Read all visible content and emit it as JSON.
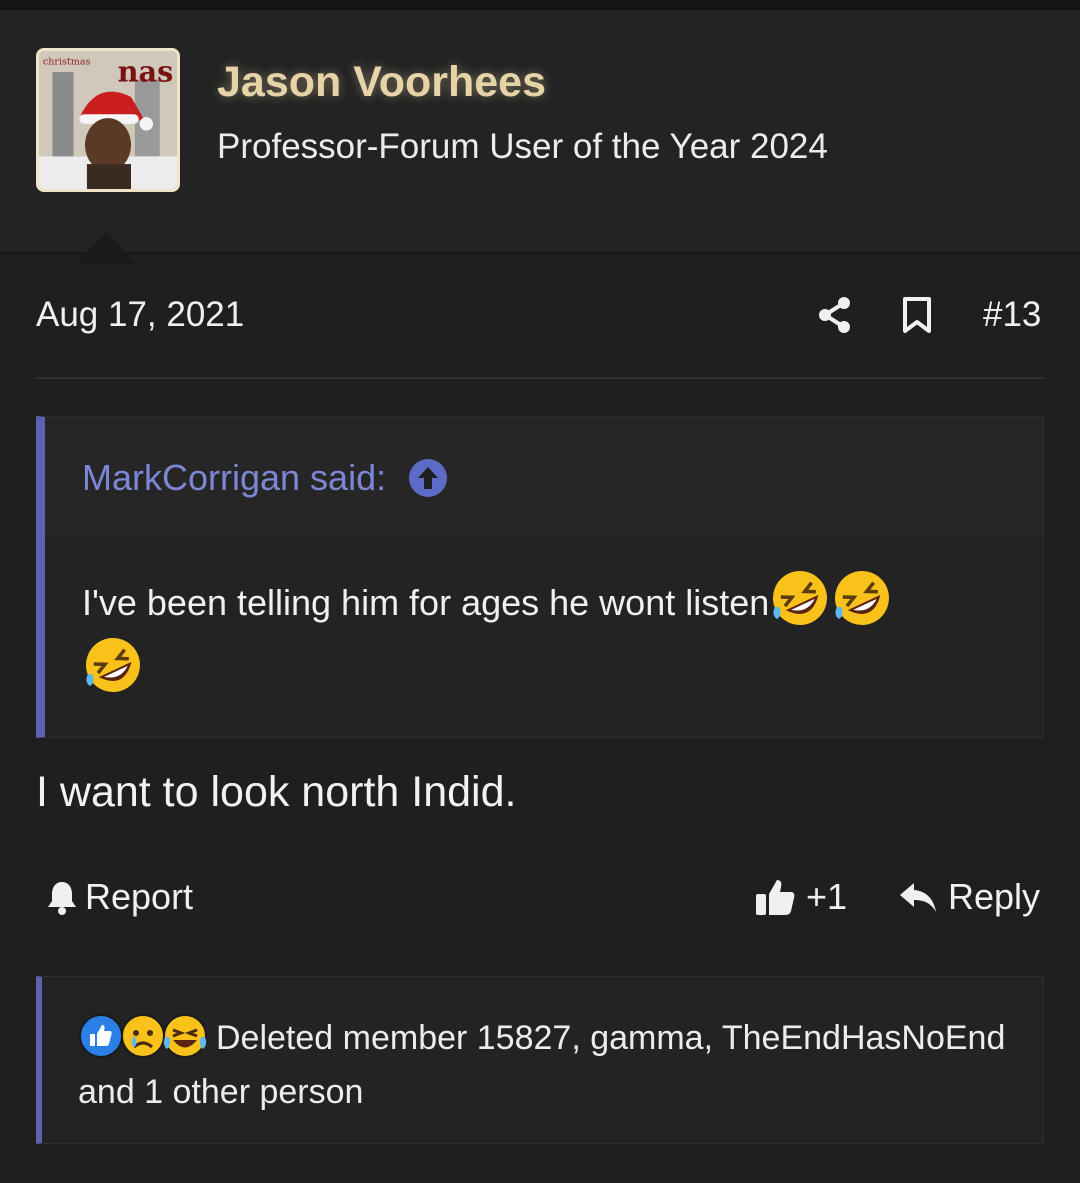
{
  "user": {
    "name": "Jason Voorhees",
    "title": "Professor-Forum User of the Year 2024",
    "avatar_album_title": "nas",
    "avatar_label": "christmas"
  },
  "post": {
    "date": "Aug 17, 2021",
    "number": "#13",
    "body": "I want to look north Indid."
  },
  "quote": {
    "author": "MarkCorrigan said:",
    "text": "I've been telling him for ages he wont listen"
  },
  "actions": {
    "report": "Report",
    "like": "+1",
    "reply": "Reply"
  },
  "reactions": {
    "text": "Deleted member 15827, gamma, TheEndHasNoEnd and 1 other person",
    "icons": [
      "like-icon",
      "sad-icon",
      "laugh-cry-icon"
    ]
  },
  "colors": {
    "accent": "#5b63b0",
    "link": "#7c88d6",
    "username": "#e6d3a8",
    "background": "#1f1f1f"
  }
}
